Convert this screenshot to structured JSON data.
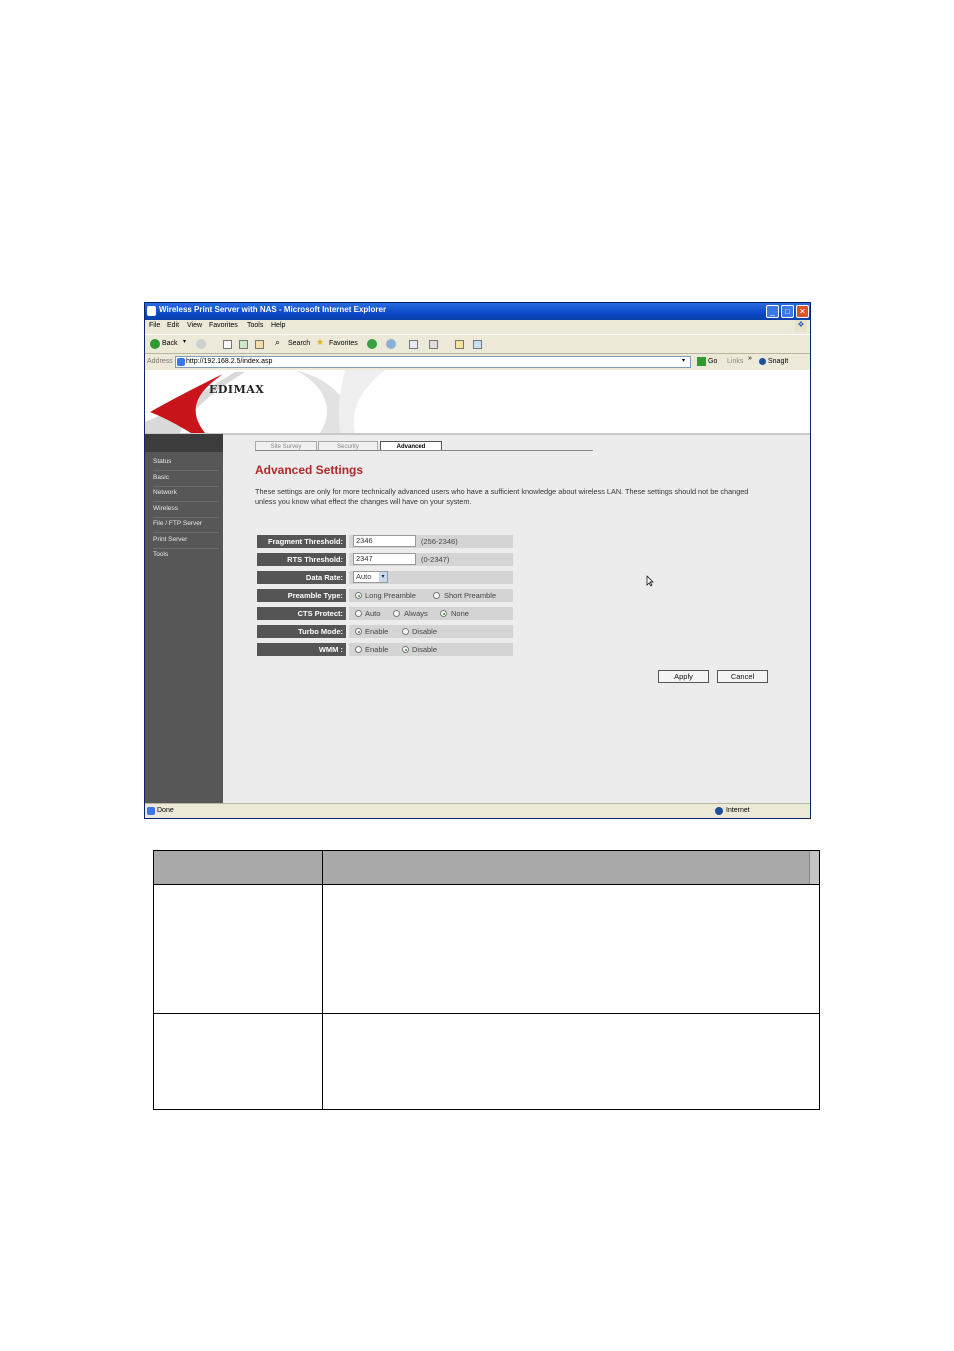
{
  "window": {
    "title": "Wireless Print Server with NAS - Microsoft Internet Explorer",
    "minimize": "_",
    "maximize": "□",
    "close": "✕"
  },
  "menu": [
    "File",
    "Edit",
    "View",
    "Favorites",
    "Tools",
    "Help"
  ],
  "toolbar": {
    "back": "Back",
    "search": "Search",
    "favorites": "Favorites"
  },
  "address": {
    "label": "Address",
    "url": "http://192.168.2.5/index.asp",
    "go": "Go",
    "links": "Links",
    "snagit": "SnagIt"
  },
  "logo": "EDIMAX",
  "sidebar": {
    "items": [
      "Status",
      "Basic",
      "Network",
      "Wireless",
      "File / FTP Server",
      "Print Server",
      "Tools"
    ]
  },
  "tabs": [
    "Site Survey",
    "Security",
    "Advanced"
  ],
  "heading": "Advanced Settings",
  "description": "These settings are only for more technically advanced users who have a sufficient knowledge about wireless LAN. These settings should not be changed unless you know what effect the changes will have on your system.",
  "settings": {
    "fragment": {
      "label": "Fragment Threshold:",
      "value": "2346",
      "hint": "(256-2346)"
    },
    "rts": {
      "label": "RTS Threshold:",
      "value": "2347",
      "hint": "(0-2347)"
    },
    "data_rate": {
      "label": "Data Rate:",
      "value": "Auto"
    },
    "preamble": {
      "label": "Preamble Type:",
      "opt1": "Long Preamble",
      "opt2": "Short Preamble"
    },
    "cts": {
      "label": "CTS Protect:",
      "opt1": "Auto",
      "opt2": "Always",
      "opt3": "None"
    },
    "turbo": {
      "label": "Turbo Mode:",
      "opt1": "Enable",
      "opt2": "Disable"
    },
    "wmm": {
      "label": "WMM :",
      "opt1": "Enable",
      "opt2": "Disable"
    }
  },
  "buttons": {
    "apply": "Apply",
    "cancel": "Cancel"
  },
  "status": {
    "left": "Done",
    "right": "Internet"
  },
  "colors": {
    "heading": "#b0282a",
    "sidebar": "#575757",
    "titlebar": "#0a48c8"
  }
}
